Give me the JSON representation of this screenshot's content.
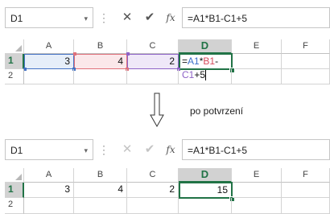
{
  "before": {
    "name_box": "D1",
    "name_box_arrow": "▾",
    "separator": "⋮",
    "cancel_icon": "✕",
    "enter_icon": "✔",
    "fx_label": "fx",
    "formula_text": "=A1*B1-C1+5",
    "columns": [
      "A",
      "B",
      "C",
      "D",
      "E",
      "F"
    ],
    "rows": [
      "1",
      "2"
    ],
    "cells": {
      "A1": "3",
      "B1": "4",
      "C1": "2",
      "D1_parts": {
        "eq": "=",
        "a1": "A1",
        "op1": "*",
        "b1": "B1",
        "op2": "-",
        "c1": "C1",
        "tail": "+5"
      }
    }
  },
  "caption": "po potvrzení",
  "after": {
    "name_box": "D1",
    "name_box_arrow": "▾",
    "separator": "⋮",
    "cancel_icon": "✕",
    "enter_icon": "✔",
    "fx_label": "fx",
    "formula_text": "=A1*B1-C1+5",
    "columns": [
      "A",
      "B",
      "C",
      "D",
      "E",
      "F"
    ],
    "rows": [
      "1",
      "2"
    ],
    "cells": {
      "A1": "3",
      "B1": "4",
      "C1": "2",
      "D1": "15"
    }
  },
  "colors": {
    "excel_green": "#217346",
    "ref_blue": "#4472c4",
    "ref_red": "#e0707a",
    "ref_purple": "#8e63c7"
  }
}
